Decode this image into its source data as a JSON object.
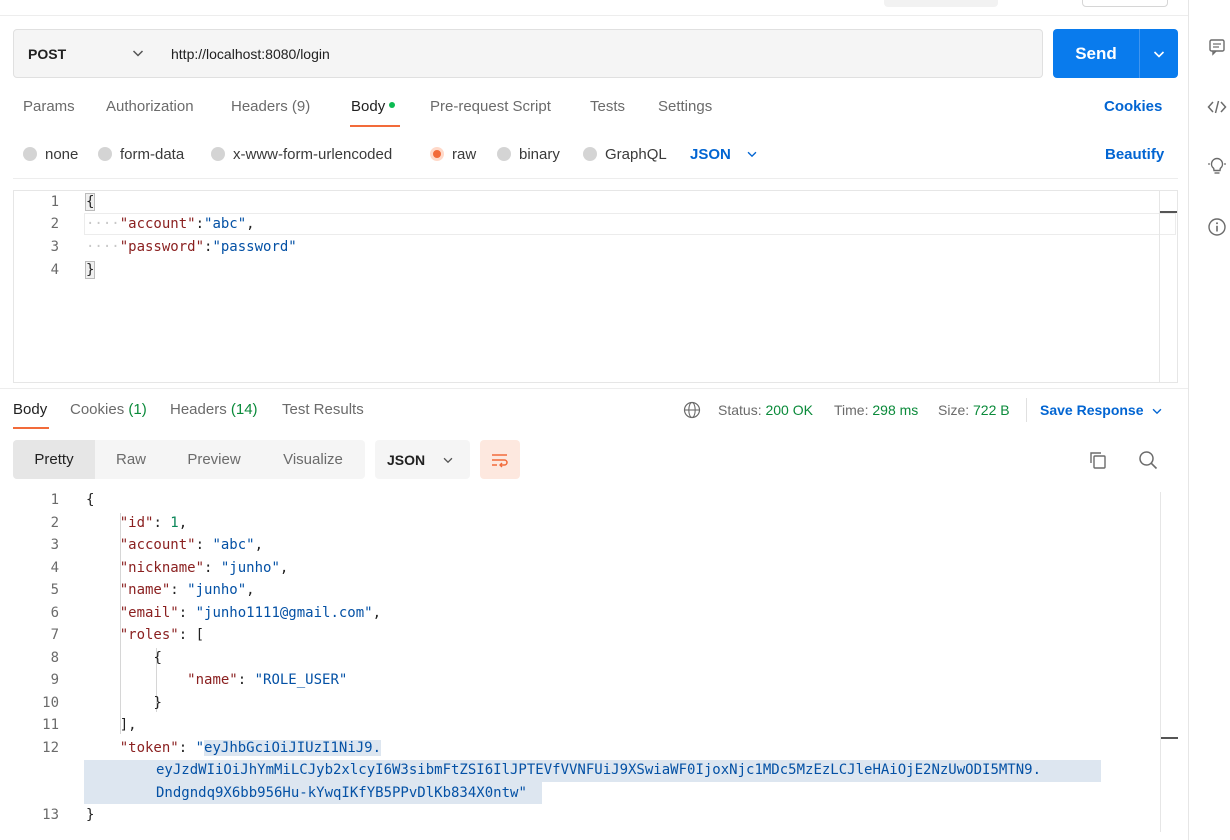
{
  "request": {
    "method": "POST",
    "url": "http://localhost:8080/login",
    "send_label": "Send"
  },
  "request_tabs": [
    {
      "label": "Params"
    },
    {
      "label": "Authorization"
    },
    {
      "label": "Headers (9)"
    },
    {
      "label": "Body"
    },
    {
      "label": "Pre-request Script"
    },
    {
      "label": "Tests"
    },
    {
      "label": "Settings"
    }
  ],
  "cookies_link": "Cookies",
  "body_modes": [
    {
      "label": "none"
    },
    {
      "label": "form-data"
    },
    {
      "label": "x-www-form-urlencoded"
    },
    {
      "label": "raw"
    },
    {
      "label": "binary"
    },
    {
      "label": "GraphQL"
    }
  ],
  "body_format": "JSON",
  "beautify_label": "Beautify",
  "request_body": {
    "line_numbers": [
      "1",
      "2",
      "3",
      "4"
    ],
    "lines": {
      "l1": "{",
      "l2_key": "\"account\"",
      "l2_colon": ":",
      "l2_val": "\"abc\"",
      "l2_comma": ",",
      "l3_key": "\"password\"",
      "l3_colon": ":",
      "l3_val": "\"password\"",
      "l4": "}"
    }
  },
  "response_tabs": [
    {
      "label": "Body"
    },
    {
      "label": "Cookies ",
      "count": "(1)"
    },
    {
      "label": "Headers ",
      "count": "(14)"
    },
    {
      "label": "Test Results"
    }
  ],
  "response_meta": {
    "status_label": "Status:",
    "status_value": "200 OK",
    "time_label": "Time:",
    "time_value": "298 ms",
    "size_label": "Size:",
    "size_value": "722 B",
    "save_label": "Save Response"
  },
  "view_modes": [
    {
      "label": "Pretty"
    },
    {
      "label": "Raw"
    },
    {
      "label": "Preview"
    },
    {
      "label": "Visualize"
    }
  ],
  "response_format": "JSON",
  "response_body": {
    "line_numbers": [
      "1",
      "2",
      "3",
      "4",
      "5",
      "6",
      "7",
      "8",
      "9",
      "10",
      "11",
      "12",
      "13"
    ],
    "open": "{",
    "id_key": "\"id\"",
    "id_val": "1",
    "account_key": "\"account\"",
    "account_val": "\"abc\"",
    "nickname_key": "\"nickname\"",
    "nickname_val": "\"junho\"",
    "name_key": "\"name\"",
    "name_val": "\"junho\"",
    "email_key": "\"email\"",
    "email_val": "\"junho1111@gmail.com\"",
    "roles_key": "\"roles\"",
    "roles_open": "[",
    "obj_open": "{",
    "role_name_key": "\"name\"",
    "role_name_val": "\"ROLE_USER\"",
    "obj_close": "}",
    "roles_close": "],",
    "token_key": "\"token\"",
    "token_part1": "eyJhbGciOiJIUzI1NiJ9.",
    "token_part2": "eyJzdWIiOiJhYmMiLCJyb2xlcyI6W3sibmFtZSI6IlJPTEVfVVNFUiJ9XSwiaWF0IjoxNjc1MDc5MzEzLCJleHAiOjE2NzUwODI5MTN9.",
    "token_part3": "Dndgndq9X6bb956Hu-kYwqIKfYB5PPvDlKb834X0ntw",
    "close": "}"
  }
}
